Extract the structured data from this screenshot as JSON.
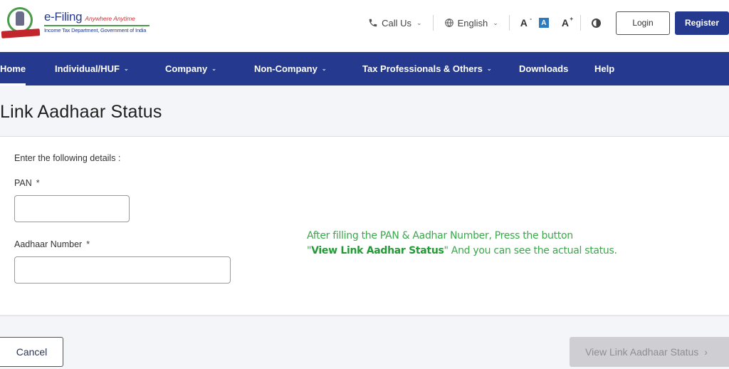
{
  "header": {
    "logo": {
      "title": "e-Filing",
      "tagline": "Anywhere Anytime",
      "subtitle": "Income Tax Department, Government of India"
    },
    "tools": {
      "call_us": "Call Us",
      "language": "English",
      "font_decrease": "A",
      "font_default": "A",
      "font_increase": "A",
      "font_decrease_mark": "-",
      "font_increase_mark": "+"
    },
    "login_label": "Login",
    "register_label": "Register"
  },
  "nav": {
    "items": [
      {
        "label": "Home",
        "active": true,
        "dropdown": false
      },
      {
        "label": "Individual/HUF",
        "active": false,
        "dropdown": true
      },
      {
        "label": "Company",
        "active": false,
        "dropdown": true
      },
      {
        "label": "Non-Company",
        "active": false,
        "dropdown": true
      },
      {
        "label": "Tax Professionals & Others",
        "active": false,
        "dropdown": true
      },
      {
        "label": "Downloads",
        "active": false,
        "dropdown": false
      },
      {
        "label": "Help",
        "active": false,
        "dropdown": false
      }
    ],
    "chevron": "⌄"
  },
  "page": {
    "title": "Link Aadhaar Status"
  },
  "form": {
    "intro": "Enter the following details :",
    "required_mark": "*",
    "pan": {
      "label": "PAN",
      "value": "",
      "placeholder": ""
    },
    "aadhaar": {
      "label": "Aadhaar Number",
      "value": "",
      "placeholder": ""
    }
  },
  "hint": {
    "line1": "After filling the PAN & Aadhar Number, Press the button",
    "quote_open": "\"",
    "highlight": "View Link Aadhar Status",
    "quote_close": "\"",
    "line2_rest": " And you can see the actual status."
  },
  "actions": {
    "cancel_label": "Cancel",
    "view_status_label": "View Link Aadhaar Status",
    "view_status_arrow": "›",
    "view_status_enabled": false
  },
  "colors": {
    "brand_blue": "#253a8e",
    "hint_green": "#3aa84a",
    "disabled_gray": "#cfcfd3"
  }
}
